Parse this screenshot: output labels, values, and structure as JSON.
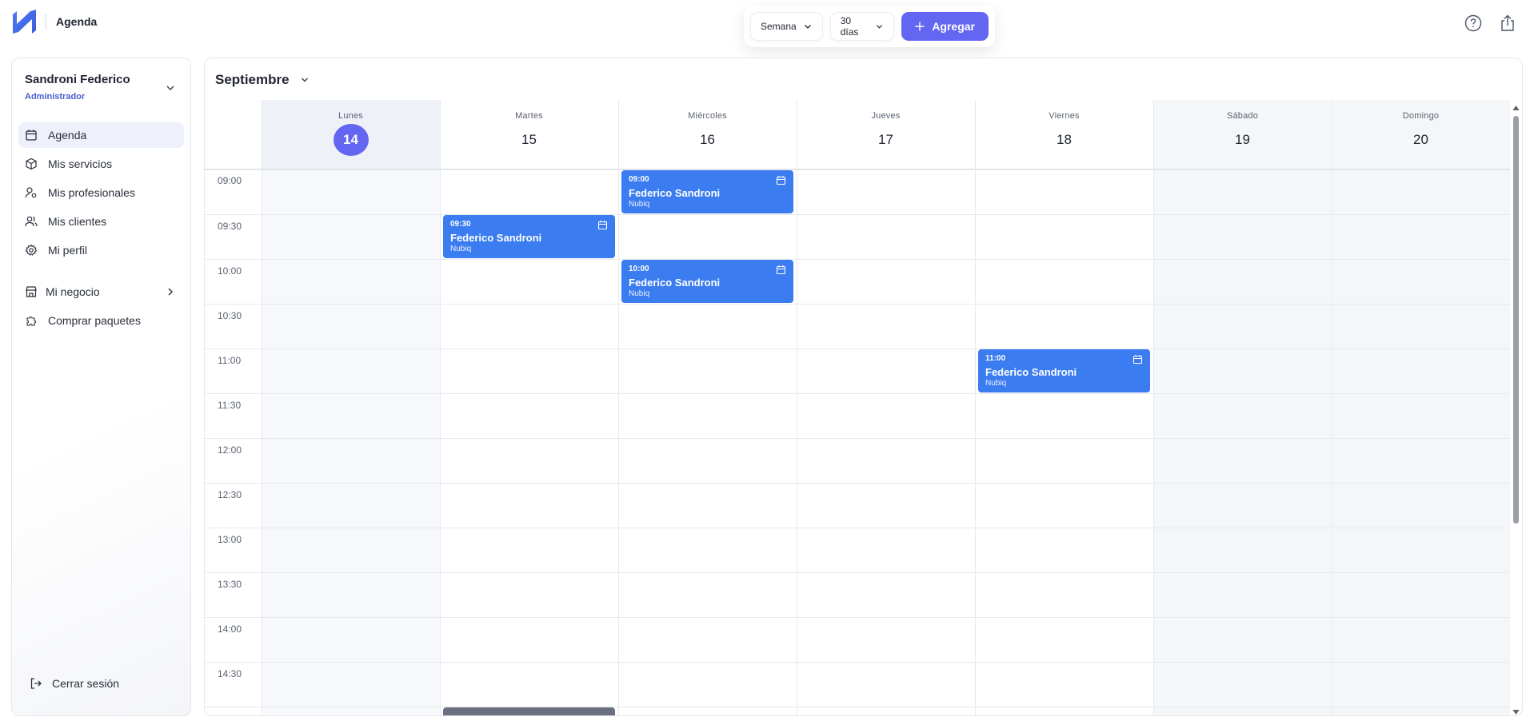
{
  "app": {
    "title": "Agenda"
  },
  "toolbar": {
    "view_label": "Semana",
    "range_label": "30 días",
    "add_label": "Agregar"
  },
  "user": {
    "name": "Sandroni Federico",
    "role": "Administrador"
  },
  "sidebar": {
    "items": [
      {
        "label": "Agenda",
        "icon": "calendar-icon",
        "active": true
      },
      {
        "label": "Mis servicios",
        "icon": "box-icon"
      },
      {
        "label": "Mis profesionales",
        "icon": "user-settings-icon"
      },
      {
        "label": "Mis clientes",
        "icon": "users-icon"
      },
      {
        "label": "Mi perfil",
        "icon": "gear-icon"
      },
      {
        "label": "Mi negocio",
        "icon": "store-icon"
      },
      {
        "label": "Comprar paquetes",
        "icon": "puzzle-icon"
      }
    ],
    "logout_label": "Cerrar sesión"
  },
  "calendar": {
    "month": "Septiembre",
    "days": [
      {
        "name": "Lunes",
        "num": "14",
        "today": true
      },
      {
        "name": "Martes",
        "num": "15"
      },
      {
        "name": "Miércoles",
        "num": "16"
      },
      {
        "name": "Jueves",
        "num": "17"
      },
      {
        "name": "Viernes",
        "num": "18"
      },
      {
        "name": "Sábado",
        "num": "19",
        "weekend": true
      },
      {
        "name": "Domingo",
        "num": "20",
        "weekend": true
      }
    ],
    "times": [
      "09:00",
      "09:30",
      "10:00",
      "10:30",
      "11:00",
      "11:30",
      "12:00",
      "12:30",
      "13:00",
      "13:30",
      "14:00",
      "14:30"
    ],
    "events": [
      {
        "day": 2,
        "time": "09:00",
        "title": "Federico Sandroni",
        "sub": "Nubiq"
      },
      {
        "day": 1,
        "time": "09:30",
        "title": "Federico Sandroni",
        "sub": "Nubiq"
      },
      {
        "day": 2,
        "time": "10:00",
        "title": "Federico Sandroni",
        "sub": "Nubiq"
      },
      {
        "day": 4,
        "time": "11:00",
        "title": "Federico Sandroni",
        "sub": "Nubiq"
      }
    ]
  },
  "colors": {
    "accent": "#6366f1",
    "event": "#3b7cf0",
    "event_muted": "#6b7080"
  }
}
